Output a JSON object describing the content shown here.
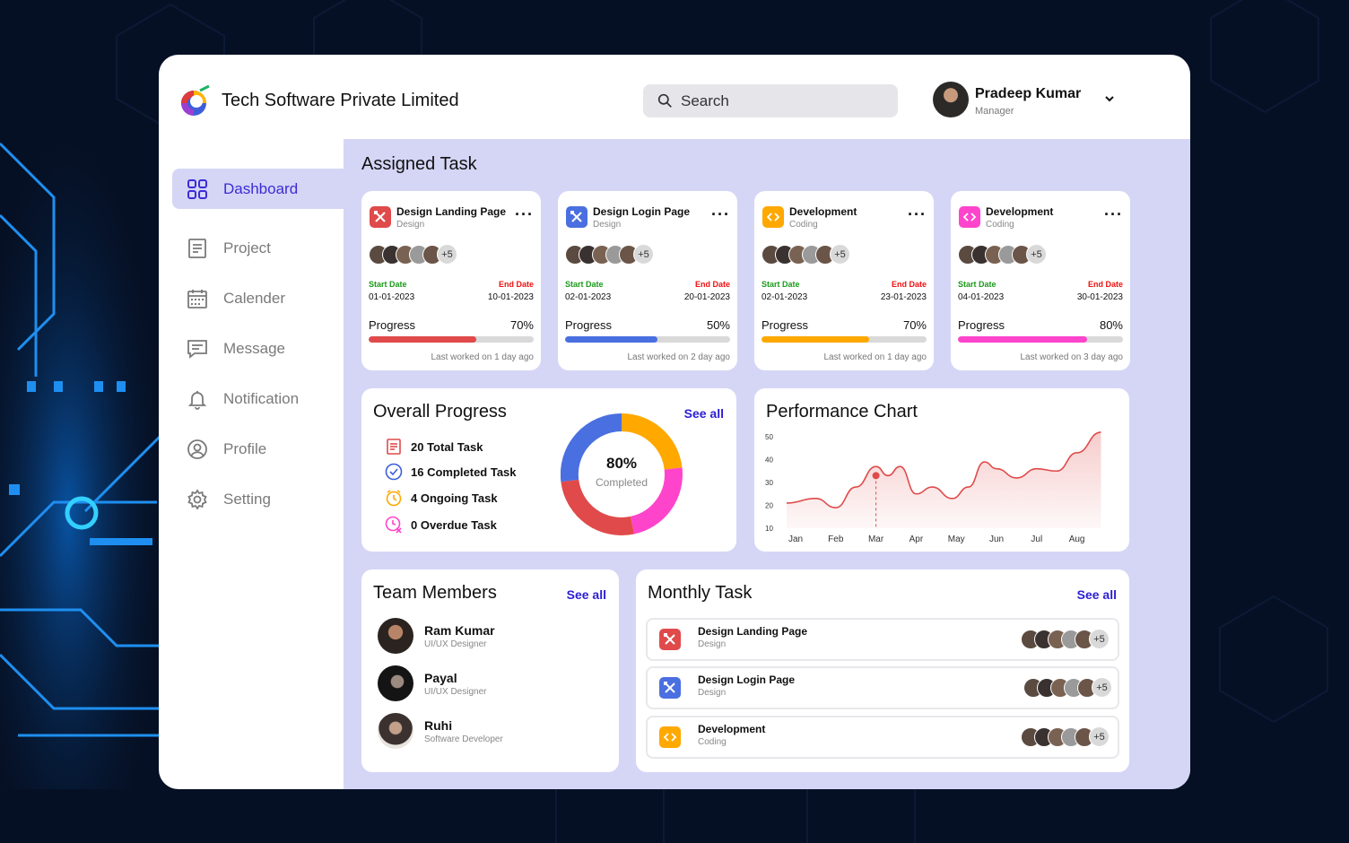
{
  "colors": {
    "accent": "#3d2bd4",
    "main_bg": "#d5d6f6",
    "design_red": "#e04a4a",
    "design_blue": "#4a6fe0",
    "coding_orange": "#ffa800",
    "coding_pink": "#ff44cc",
    "start_green": "#1a9a1a",
    "end_red": "#e11111",
    "chart_line": "#e04a4a"
  },
  "header": {
    "company": "Tech Software Private Limited",
    "search_placeholder": "Search",
    "user": {
      "name": "Pradeep Kumar",
      "role": "Manager"
    }
  },
  "sidebar": {
    "items": [
      {
        "label": "Dashboard",
        "icon": "grid-icon",
        "active": true
      },
      {
        "label": "Project",
        "icon": "document-icon"
      },
      {
        "label": "Calender",
        "icon": "calendar-icon"
      },
      {
        "label": "Message",
        "icon": "message-icon"
      },
      {
        "label": "Notification",
        "icon": "bell-icon"
      },
      {
        "label": "Profile",
        "icon": "user-icon"
      },
      {
        "label": "Setting",
        "icon": "gear-icon"
      }
    ]
  },
  "assigned": {
    "title": "Assigned Task",
    "start_label": "Start Date",
    "end_label": "End Date",
    "progress_label": "Progress",
    "cards": [
      {
        "title": "Design Landing Page",
        "category": "Design",
        "icon": "design-tools-icon",
        "more": "+5",
        "start": "01-01-2023",
        "end": "10-01-2023",
        "progress": "70%",
        "progress_value": 0.65,
        "last": "Last worked on 1 day ago"
      },
      {
        "title": "Design Login Page",
        "category": "Design",
        "icon": "design-tools-icon",
        "more": "+5",
        "start": "02-01-2023",
        "end": "20-01-2023",
        "progress": "50%",
        "progress_value": 0.56,
        "last": "Last worked on 2 day ago"
      },
      {
        "title": "Development",
        "category": "Coding",
        "icon": "code-icon",
        "more": "+5",
        "start": "02-01-2023",
        "end": "23-01-2023",
        "progress": "70%",
        "progress_value": 0.65,
        "last": "Last worked on 1 day ago"
      },
      {
        "title": "Development",
        "category": "Coding",
        "icon": "code-icon",
        "more": "+5",
        "start": "04-01-2023",
        "end": "30-01-2023",
        "progress": "80%",
        "progress_value": 0.78,
        "last": "Last worked on 3 day ago"
      }
    ]
  },
  "overall": {
    "title": "Overall Progress",
    "see_all": "See all",
    "stats": [
      {
        "text": "20  Total Task",
        "icon": "list-icon"
      },
      {
        "text": "16  Completed Task",
        "icon": "check-circle-icon"
      },
      {
        "text": "4  Ongoing Task",
        "icon": "clock-icon"
      },
      {
        "text": "0  Overdue Task",
        "icon": "overdue-clock-icon"
      }
    ],
    "donut_value": "80%",
    "donut_label": "Completed"
  },
  "performance": {
    "title": "Performance Chart"
  },
  "chart_data": {
    "type": "area",
    "title": "Performance Chart",
    "categories": [
      "Jan",
      "Feb",
      "Mar",
      "Apr",
      "May",
      "Jun",
      "Jul",
      "Aug"
    ],
    "yticks": [
      10,
      20,
      30,
      40,
      50
    ],
    "ylim": [
      10,
      50
    ],
    "x": [
      0,
      0.5,
      1,
      1.5,
      2,
      2.3,
      2.6,
      3,
      3.4,
      3.9,
      4.3,
      4.7,
      5,
      5.5,
      6,
      6.5,
      7,
      7.6
    ],
    "values": [
      21,
      23,
      19,
      28,
      37,
      33,
      37,
      25,
      28,
      23,
      28,
      39,
      36,
      32,
      36,
      35,
      43,
      52
    ],
    "highlight": {
      "category": "Mar",
      "value": 33
    },
    "grid": false
  },
  "team": {
    "title": "Team Members",
    "see_all": "See all",
    "members": [
      {
        "name": "Ram Kumar",
        "role": "UI/UX Designer"
      },
      {
        "name": "Payal",
        "role": "UI/UX Designer"
      },
      {
        "name": "Ruhi",
        "role": "Software Developer"
      }
    ]
  },
  "monthly": {
    "title": "Monthly Task",
    "see_all": "See all",
    "rows": [
      {
        "title": "Design Landing Page",
        "category": "Design",
        "icon": "design-tools-icon",
        "more": "+5"
      },
      {
        "title": "Design Login Page",
        "category": "Design",
        "icon": "design-tools-icon",
        "more": "+5"
      },
      {
        "title": "Development",
        "category": "Coding",
        "icon": "code-icon",
        "more": "+5"
      }
    ]
  }
}
